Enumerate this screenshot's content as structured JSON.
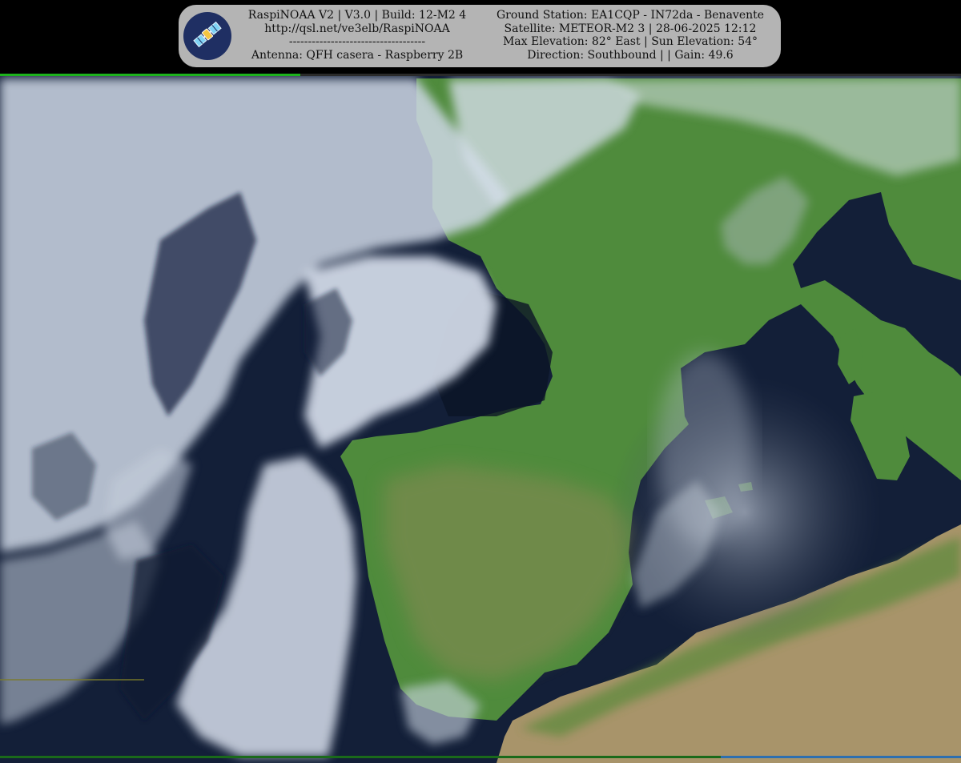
{
  "overlay": {
    "left_lines": [
      "RaspiNOAA V2 | V3.0 | Build: 12-M2 4",
      "http://qsl.net/ve3elb/RaspiNOAA",
      "------------------------------------",
      "Antenna: QFH casera - Raspberry 2B"
    ],
    "right_lines": [
      "Ground Station: EA1CQP - IN72da - Benavente",
      "Satellite: METEOR-M2 3 | 28-06-2025 12:12",
      "Max Elevation: 82° East | Sun Elevation: 54°",
      "Direction: Southbound | | Gain: 49.6"
    ],
    "logo_icon": "satellite-icon"
  },
  "colors": {
    "background": "#000000",
    "panel": "#b4b4b4",
    "panel_text": "#111111",
    "logo_circle": "#1f2f63",
    "sea": "#101b30",
    "land": "#4e8a3c",
    "desert": "#a8946a",
    "cloud": "#d9e2ef"
  }
}
